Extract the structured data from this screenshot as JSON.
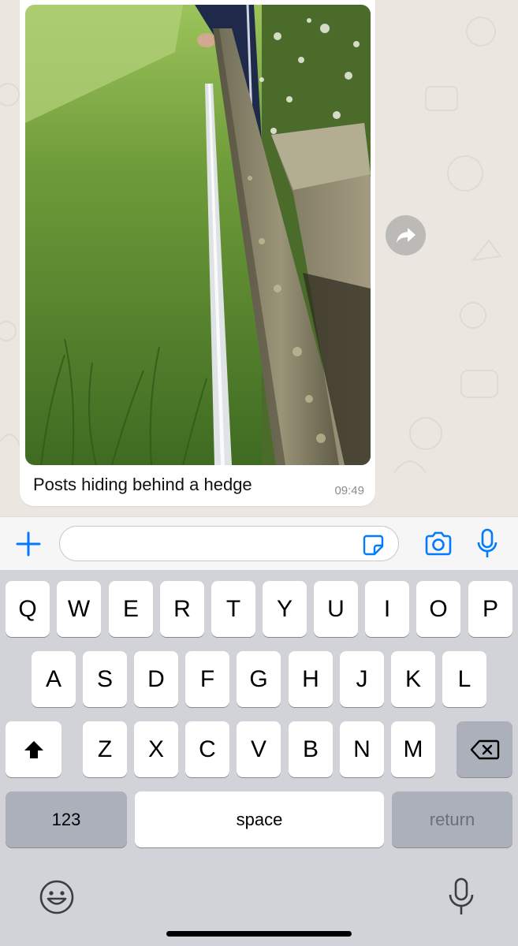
{
  "chat": {
    "message": {
      "caption": "Posts hiding behind a hedge",
      "time": "09:49",
      "image_description_icon": "photo"
    },
    "forward_icon": "forward-arrow-icon"
  },
  "input_bar": {
    "text_value": "",
    "icons": [
      "plus-icon",
      "sticker-icon",
      "camera-icon",
      "microphone-icon"
    ],
    "accent_color": "#007aff"
  },
  "keyboard": {
    "row1": [
      "Q",
      "W",
      "E",
      "R",
      "T",
      "Y",
      "U",
      "I",
      "O",
      "P"
    ],
    "row2": [
      "A",
      "S",
      "D",
      "F",
      "G",
      "H",
      "J",
      "K",
      "L"
    ],
    "row3": [
      "Z",
      "X",
      "C",
      "V",
      "B",
      "N",
      "M"
    ],
    "numbers_label": "123",
    "space_label": "space",
    "return_label": "return"
  }
}
